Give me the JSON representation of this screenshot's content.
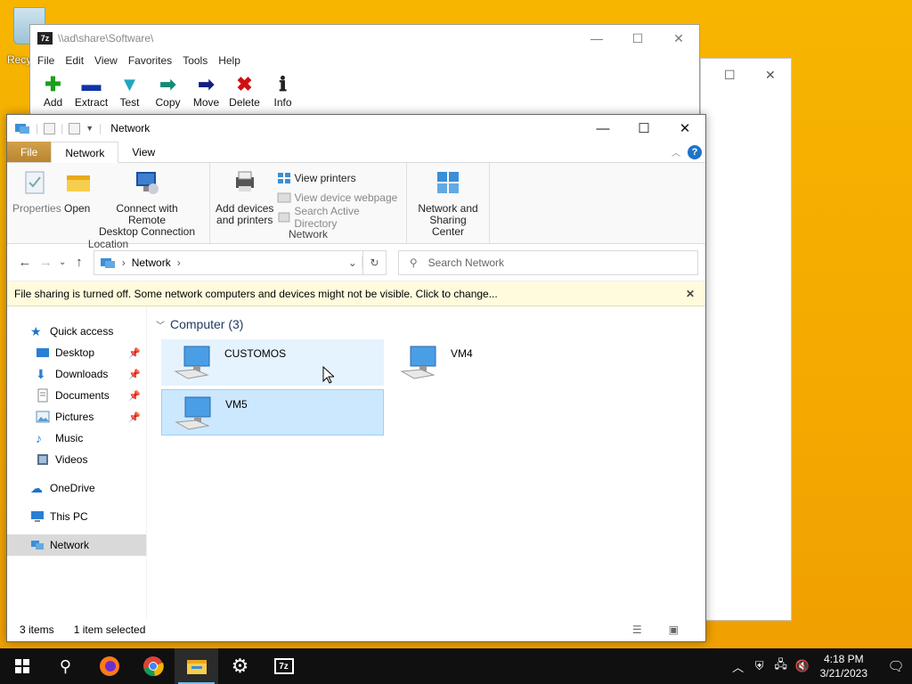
{
  "desktop": {
    "recycle_label": "Recy"
  },
  "sevenzip": {
    "title": "\\\\ad\\share\\Software\\",
    "logo": "7z",
    "menu": [
      "File",
      "Edit",
      "View",
      "Favorites",
      "Tools",
      "Help"
    ],
    "toolbar": [
      {
        "label": "Add",
        "icon": "add-icon",
        "color": "#1aa01a"
      },
      {
        "label": "Extract",
        "icon": "extract-icon",
        "color": "#1133aa"
      },
      {
        "label": "Test",
        "icon": "test-icon",
        "color": "#1fa7c0"
      },
      {
        "label": "Copy",
        "icon": "copy-icon",
        "color": "#168a78"
      },
      {
        "label": "Move",
        "icon": "move-icon",
        "color": "#101f80"
      },
      {
        "label": "Delete",
        "icon": "delete-icon",
        "color": "#d01010"
      },
      {
        "label": "Info",
        "icon": "info-icon",
        "color": "#222"
      }
    ]
  },
  "explorer": {
    "title": "Network",
    "tabs": {
      "file": "File",
      "network": "Network",
      "view": "View"
    },
    "help": "?",
    "ribbon": {
      "location": {
        "name": "Location",
        "properties": "Properties",
        "open": "Open",
        "connect_line1": "Connect with Remote",
        "connect_line2": "Desktop Connection"
      },
      "network": {
        "name": "Network",
        "add_line1": "Add devices",
        "add_line2": "and printers",
        "view_printers": "View printers",
        "view_device_webpage": "View device webpage",
        "search_ad": "Search Active Directory"
      },
      "nsc": {
        "line1": "Network and",
        "line2": "Sharing Center"
      }
    },
    "address": {
      "location": "Network"
    },
    "search": {
      "placeholder": "Search Network"
    },
    "infobar": "File sharing is turned off. Some network computers and devices might not be visible. Click to change...",
    "nav": {
      "quick_access": "Quick access",
      "desktop": "Desktop",
      "downloads": "Downloads",
      "documents": "Documents",
      "pictures": "Pictures",
      "music": "Music",
      "videos": "Videos",
      "onedrive": "OneDrive",
      "thispc": "This PC",
      "network": "Network"
    },
    "group": "Computer (3)",
    "computers": [
      "CUSTOMOS",
      "VM4",
      "VM5"
    ],
    "status": {
      "items": "3 items",
      "selected": "1 item selected"
    }
  },
  "taskbar": {
    "time": "4:18 PM",
    "date": "3/21/2023",
    "pinned": [
      "start-icon",
      "search-icon",
      "firefox-icon",
      "chrome-icon",
      "file-explorer-icon",
      "settings-icon",
      "7zip-icon"
    ],
    "sevenzip_label": "7z"
  },
  "colors": {
    "selection": "#cce8ff",
    "accent": "#1e74c8",
    "desktop": "#f6b400"
  }
}
